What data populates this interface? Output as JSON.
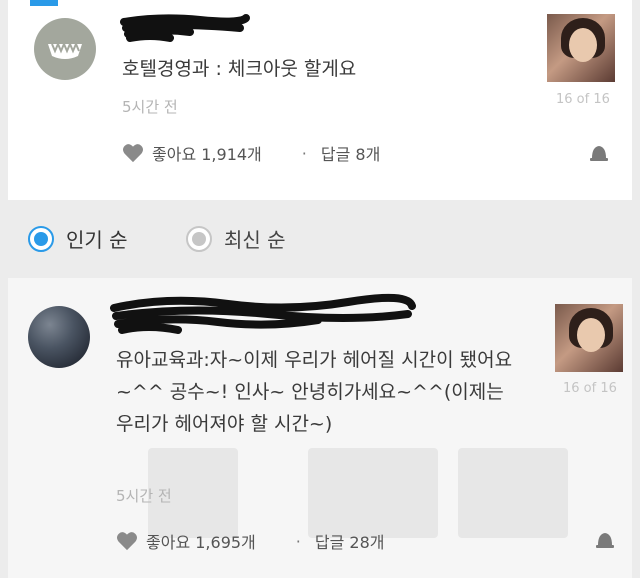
{
  "comments": [
    {
      "text": "호텔경영과 : 체크아웃 할게요",
      "time": "5시간 전",
      "pager": "16 of 16",
      "likes_label": "좋아요 1,914개",
      "replies_label": "답글 8개",
      "dot": "·"
    },
    {
      "text": "유아교육과:자~이제 우리가 헤어질 시간이 됐어요~^^ 공수~! 인사~ 안녕히가세요~^^(이제는 우리가 헤어져야 할 시간~)",
      "time": "5시간 전",
      "pager": "16 of 16",
      "likes_label": "좋아요 1,695개",
      "replies_label": "답글 28개",
      "dot": "·"
    }
  ],
  "sort": {
    "popular_label": "인기 순",
    "recent_label": "최신 순",
    "selected": "popular"
  },
  "colors": {
    "accent": "#2a9ae8",
    "muted": "#b4b4b4"
  },
  "icons": [
    "heart-icon",
    "bell-icon",
    "radio-selected-icon",
    "radio-unselected-icon"
  ]
}
